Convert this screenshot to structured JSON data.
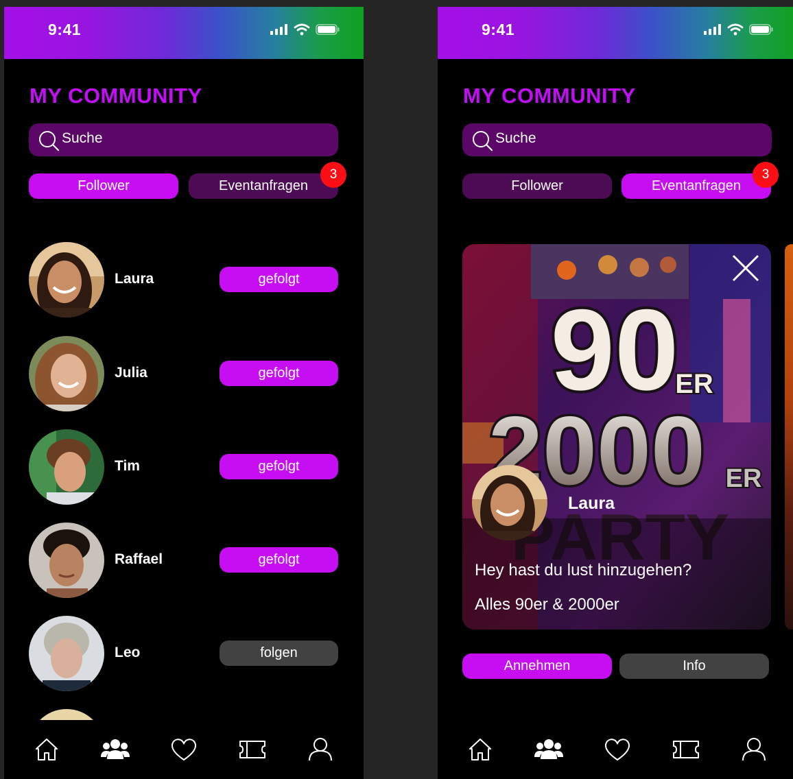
{
  "status_bar": {
    "time": "9:41"
  },
  "page_title": "MY COMMUNITY",
  "search": {
    "placeholder": "Suche"
  },
  "tabs": {
    "follower": "Follower",
    "event_requests": "Eventanfragen",
    "badge_count": "3"
  },
  "people": [
    {
      "name": "Laura",
      "action": "gefolgt",
      "following": true
    },
    {
      "name": "Julia",
      "action": "gefolgt",
      "following": true
    },
    {
      "name": "Tim",
      "action": "gefolgt",
      "following": true
    },
    {
      "name": "Raffael",
      "action": "gefolgt",
      "following": true
    },
    {
      "name": "Leo",
      "action": "folgen",
      "following": false
    }
  ],
  "request_card": {
    "poster_line1": "90",
    "poster_er1": "ER",
    "poster_line2": "2000",
    "poster_er2": "ER",
    "poster_line3": "PARTY",
    "sender_name": "Laura",
    "message": "Hey hast du lust hinzugehen?",
    "event_name": "Alles 90er & 2000er"
  },
  "actions": {
    "accept": "Annehmen",
    "info": "Info"
  },
  "bottom_nav": [
    "home-icon",
    "community-icon",
    "heart-icon",
    "ticket-icon",
    "profile-icon"
  ],
  "colors": {
    "accent": "#c70ef2",
    "search_bg": "#5b0767",
    "inactive_tab": "#4d0b56",
    "badge": "#fb0e16",
    "unfollowed": "#424242"
  }
}
